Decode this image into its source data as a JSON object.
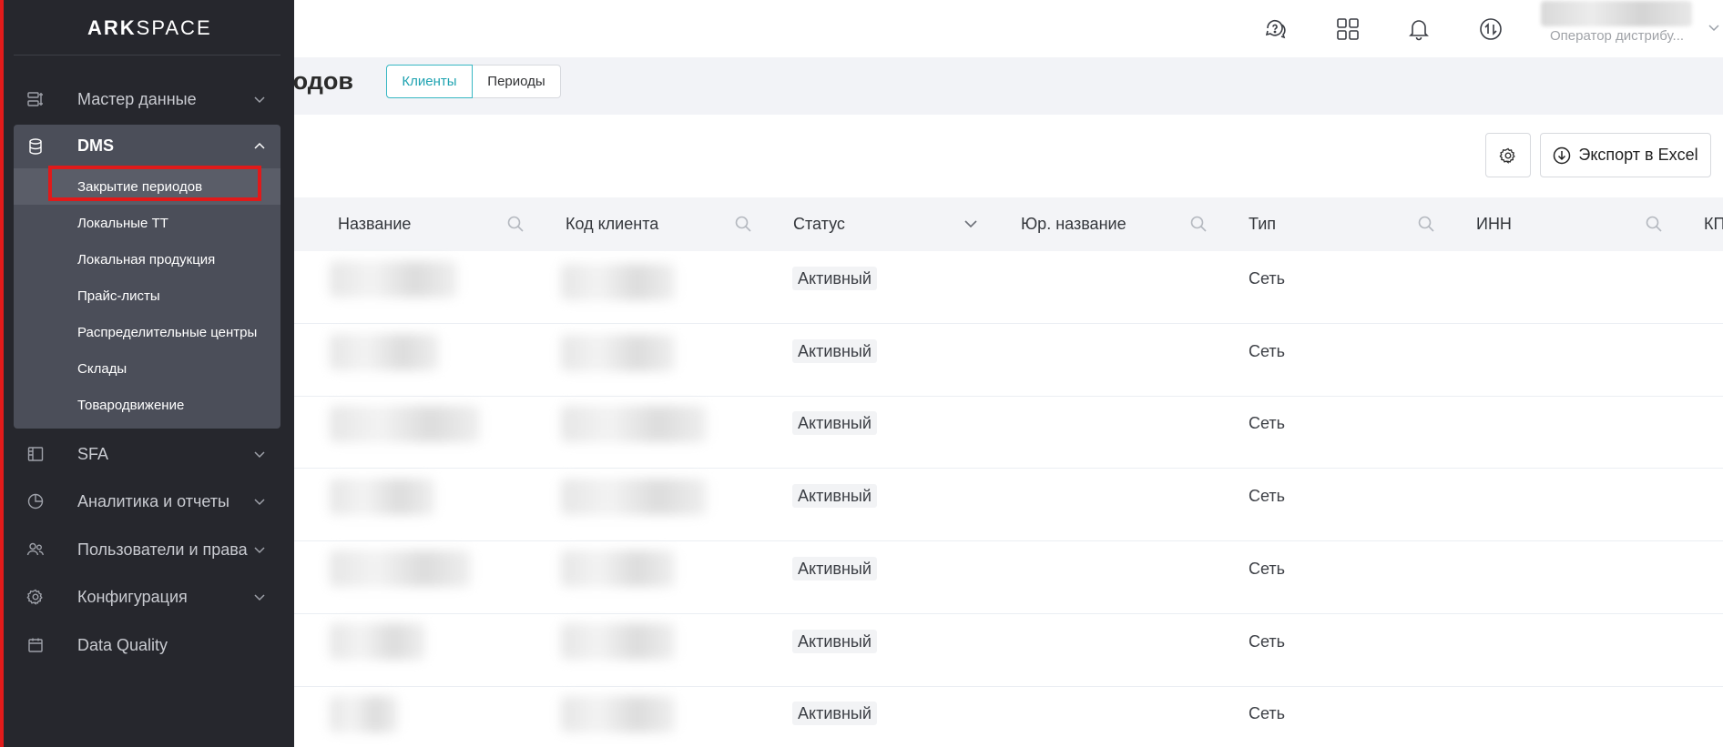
{
  "app": {
    "logo_bold": "ARK",
    "logo_light": "SPACE"
  },
  "header": {
    "icons": [
      "support-chat-icon",
      "apps-grid-icon",
      "bell-icon",
      "sync-arrows-icon"
    ],
    "user_role": "Оператор дистрибу..."
  },
  "page": {
    "title": "Закрытие периодов",
    "tabs": [
      {
        "label": "Клиенты",
        "active": true
      },
      {
        "label": "Периоды",
        "active": false
      }
    ]
  },
  "toolbar": {
    "export_label": "Экспорт в Excel"
  },
  "table": {
    "columns": [
      "Название",
      "Код клиента",
      "Статус",
      "Юр. название",
      "Тип",
      "ИНН",
      "КП"
    ],
    "rows": [
      {
        "name": "",
        "code": "",
        "status": "Активный",
        "legal_name": "",
        "type": "Сеть",
        "inn": ""
      },
      {
        "name": "",
        "code": "",
        "status": "Активный",
        "legal_name": "",
        "type": "Сеть",
        "inn": ""
      },
      {
        "name": "",
        "code": "",
        "status": "Активный",
        "legal_name": "",
        "type": "Сеть",
        "inn": ""
      },
      {
        "name": "",
        "code": "",
        "status": "Активный",
        "legal_name": "",
        "type": "Сеть",
        "inn": ""
      },
      {
        "name": "",
        "code": "",
        "status": "Активный",
        "legal_name": "",
        "type": "Сеть",
        "inn": ""
      },
      {
        "name": "",
        "code": "",
        "status": "Активный",
        "legal_name": "",
        "type": "Сеть",
        "inn": ""
      },
      {
        "name": "",
        "code": "",
        "status": "Активный",
        "legal_name": "",
        "type": "Сеть",
        "inn": ""
      }
    ]
  },
  "sidebar": {
    "items": [
      {
        "label": "Мастер данные",
        "icon": "master-data-icon"
      },
      {
        "label": "DMS",
        "icon": "database-icon",
        "expanded": true
      },
      {
        "label": "SFA",
        "icon": "sfa-icon"
      },
      {
        "label": "Аналитика и отчеты",
        "icon": "analytics-icon"
      },
      {
        "label": "Пользователи и права",
        "icon": "users-icon"
      },
      {
        "label": "Конфигурация",
        "icon": "gear-icon"
      },
      {
        "label": "Data Quality",
        "icon": "calendar-icon"
      }
    ],
    "dms_sub": [
      "Закрытие периодов",
      "Локальные ТТ",
      "Локальная продукция",
      "Прайс-листы",
      "Распределительные центры",
      "Склады",
      "Товародвижение"
    ]
  },
  "colors": {
    "sidebar_bg": "#26272d",
    "accent": "#37b7c3",
    "highlight": "#e01a1a"
  }
}
